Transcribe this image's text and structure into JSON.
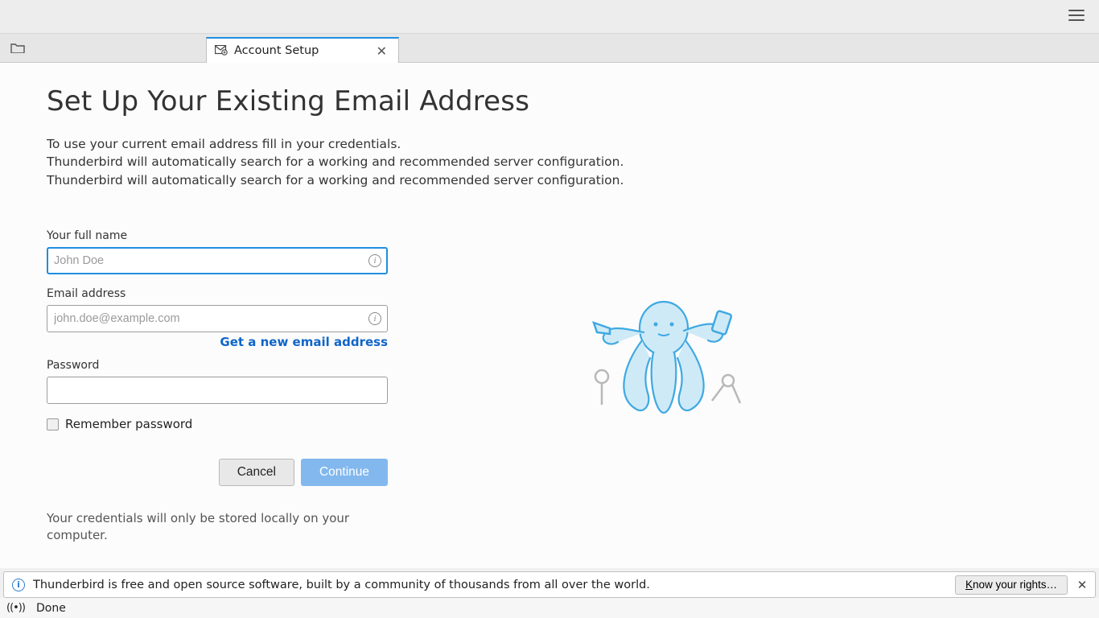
{
  "tab": {
    "label": "Account Setup"
  },
  "page": {
    "heading": "Set Up Your Existing Email Address",
    "intro1": "To use your current email address fill in your credentials.",
    "intro2": "Thunderbird will automatically search for a working and recommended server configuration.",
    "intro3": "Thunderbird will automatically search for a working and recommended server configuration."
  },
  "form": {
    "name_label": "Your full name",
    "name_placeholder": "John Doe",
    "name_value": "",
    "email_label": "Email address",
    "email_placeholder": "john.doe@example.com",
    "email_value": "",
    "new_email_link": "Get a new email address",
    "password_label": "Password",
    "password_value": "",
    "remember_label": "Remember password",
    "cancel": "Cancel",
    "continue": "Continue",
    "disclaimer": "Your credentials will only be stored locally on your computer."
  },
  "notif": {
    "message": "Thunderbird is free and open source software, built by a community of thousands from all over the world.",
    "rights_prefix": "K",
    "rights_rest": "now your rights…"
  },
  "status": {
    "text": "Done"
  }
}
